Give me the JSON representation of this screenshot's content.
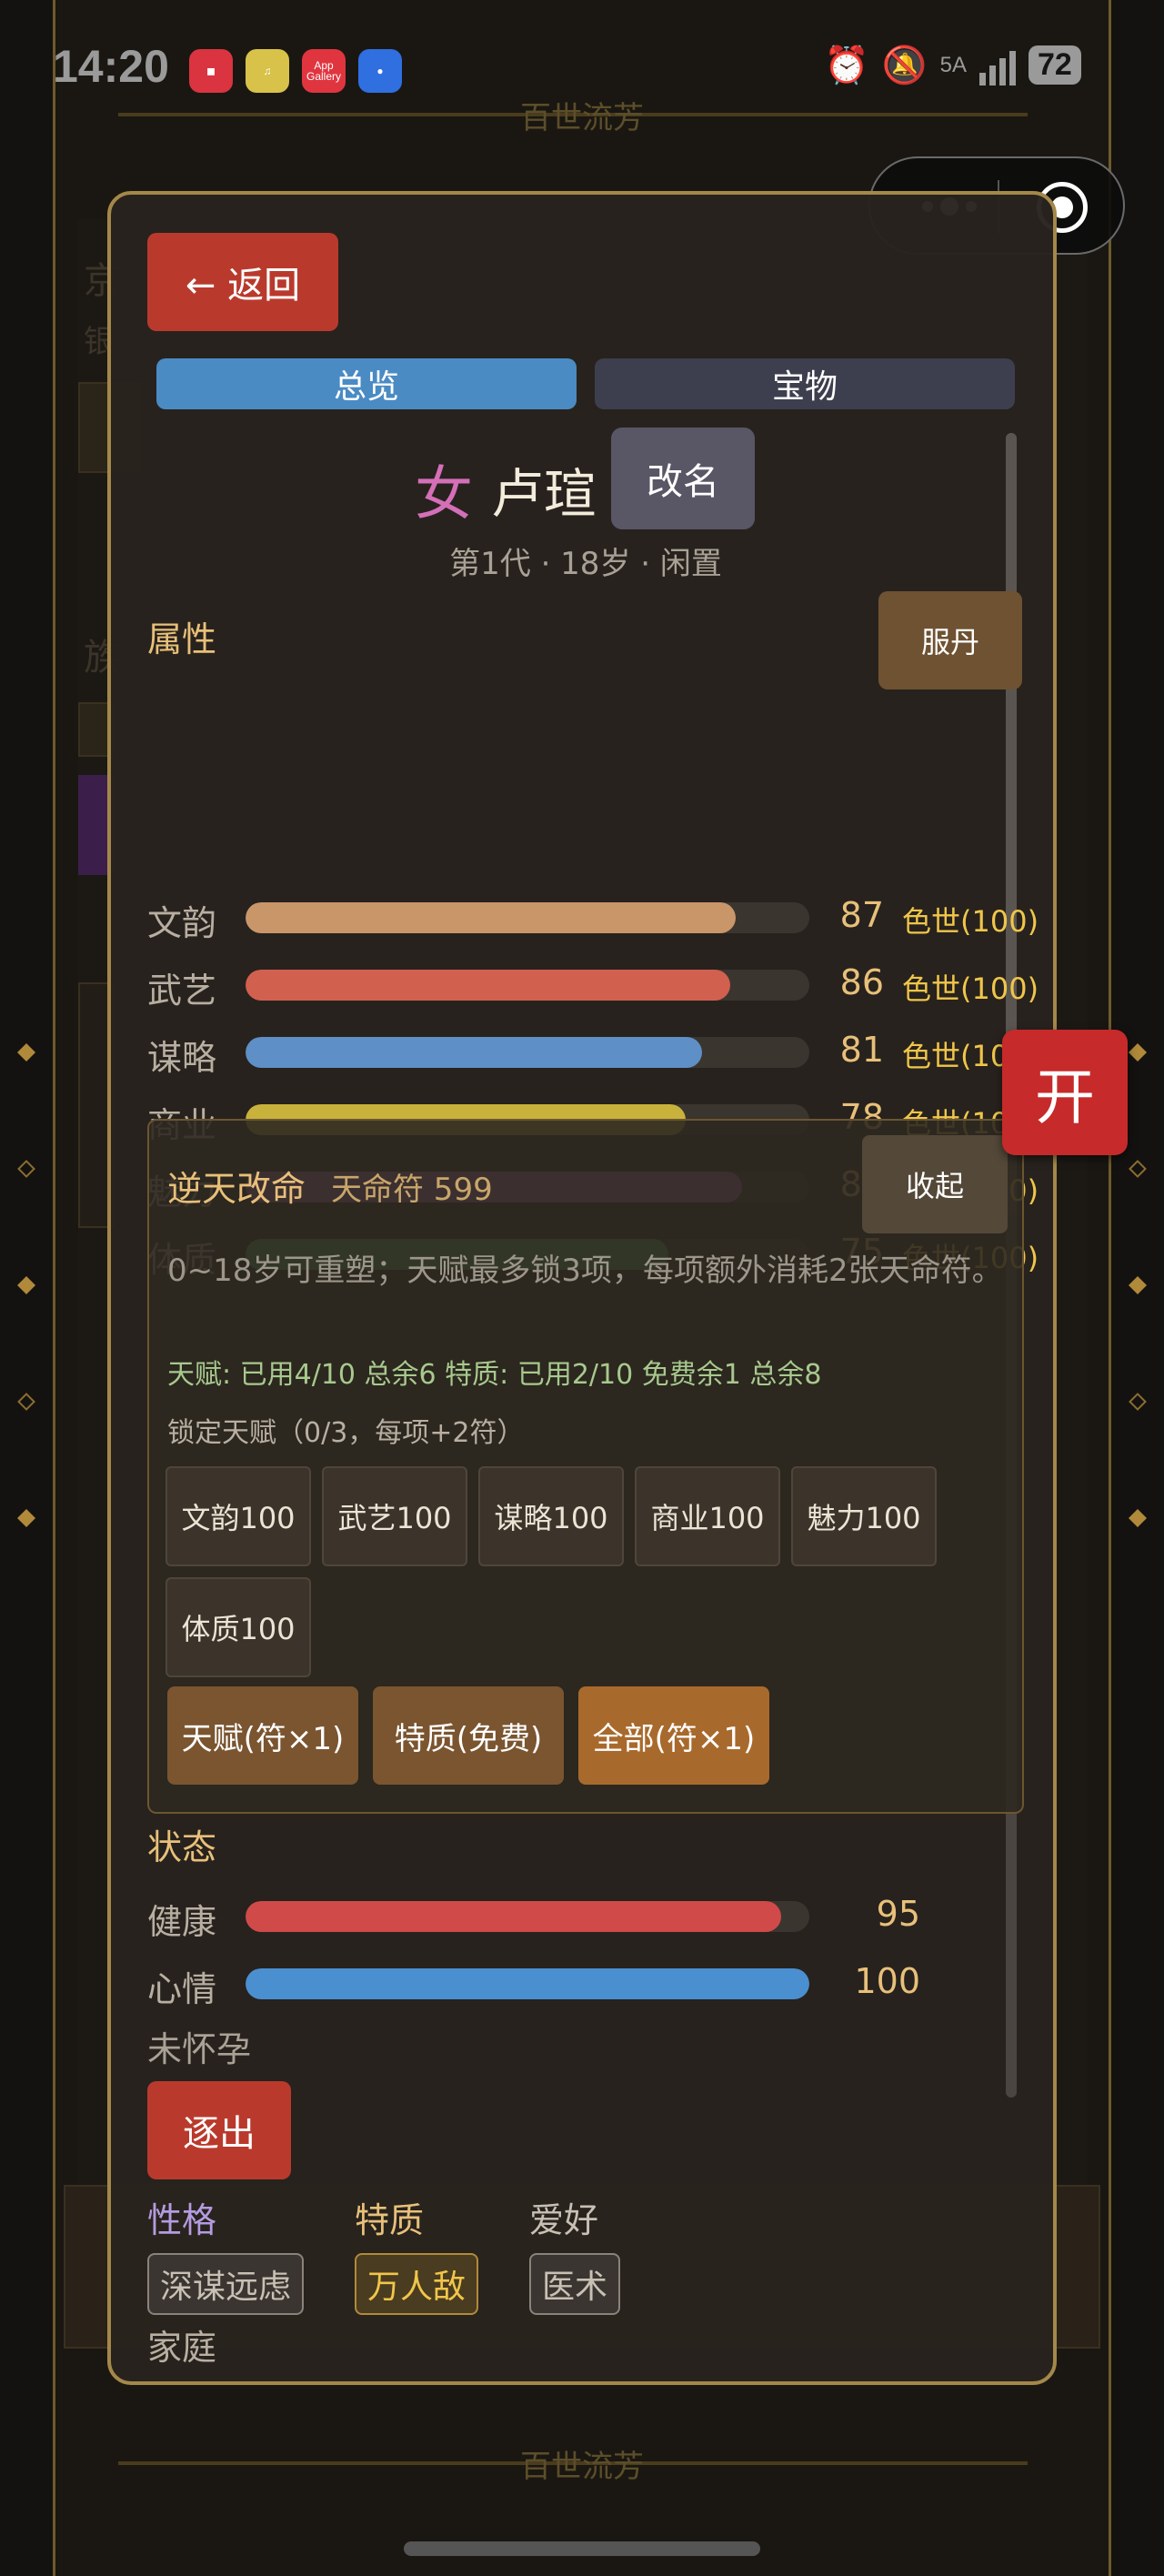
{
  "status_bar": {
    "time": "14:20",
    "apps": [
      {
        "name": "book-app-icon",
        "label": "",
        "color": "#d9343f"
      },
      {
        "name": "music-app-icon",
        "label": "",
        "color": "#d8c24a"
      },
      {
        "name": "app-gallery-icon",
        "label": "App Gallery",
        "color": "#e0353f"
      },
      {
        "name": "message-app-icon",
        "label": "",
        "color": "#2f6fe0"
      }
    ],
    "network": "5A",
    "battery": "72"
  },
  "background": {
    "scroll_title_top": "百世流芳",
    "scroll_title_bottom": "百世流芳"
  },
  "modal": {
    "back_label": "← 返回",
    "tabs": [
      {
        "label": "总览",
        "active": true
      },
      {
        "label": "宝物",
        "active": false
      }
    ],
    "character": {
      "gender": "女",
      "name": "卢瑄",
      "rename_label": "改名",
      "subline": "第1代 · 18岁 · 闲置"
    },
    "attributes": {
      "title": "属性",
      "pill_label": "服丹",
      "cap_label": "色世(100)",
      "items": [
        {
          "label": "文韵",
          "value": 87,
          "max": 100,
          "color": "#c9966a"
        },
        {
          "label": "武艺",
          "value": 86,
          "max": 100,
          "color": "#d1604f"
        },
        {
          "label": "谋略",
          "value": 81,
          "max": 100,
          "color": "#5e8fc6"
        },
        {
          "label": "商业",
          "value": 78,
          "max": 100,
          "color": "#c9b23c"
        },
        {
          "label": "魅力",
          "value": 88,
          "max": 100,
          "color": "#c370b5"
        },
        {
          "label": "体质",
          "value": 75,
          "max": 100,
          "color": "#5db86c"
        }
      ]
    },
    "reforge": {
      "title": "逆天改命",
      "coins": "天命符 599",
      "collapse_label": "收起",
      "desc": "0~18岁可重塑；天赋最多锁3项，每项额外消耗2张天命符。",
      "usage": "天赋: 已用4/10 总余6   特质: 已用2/10 免费余1 总余8",
      "lock_label": "锁定天赋（0/3，每项+2符）",
      "talents": [
        "文韵100",
        "武艺100",
        "谋略100",
        "商业100",
        "魅力100",
        "体质100"
      ],
      "actions": [
        "天赋(符×1)",
        "特质(免费)",
        "全部(符×1)"
      ]
    },
    "status": {
      "title": "状态",
      "items": [
        {
          "label": "健康",
          "value": 95,
          "max": 100,
          "color": "#d04a4a"
        },
        {
          "label": "心情",
          "value": 100,
          "max": 100,
          "color": "#4a8fd0"
        }
      ],
      "pregnancy": "未怀孕"
    },
    "expel_label": "逐出",
    "traits": {
      "personality": {
        "title": "性格",
        "tag": "深谋远虑",
        "color": "#b59be0"
      },
      "feature": {
        "title": "特质",
        "tag": "万人敌",
        "color": "#e8c07a"
      },
      "hobby": {
        "title": "爱好",
        "tag": "医术",
        "color": "#c8c0b4"
      }
    },
    "family_label": "家庭"
  },
  "float_button": "开"
}
